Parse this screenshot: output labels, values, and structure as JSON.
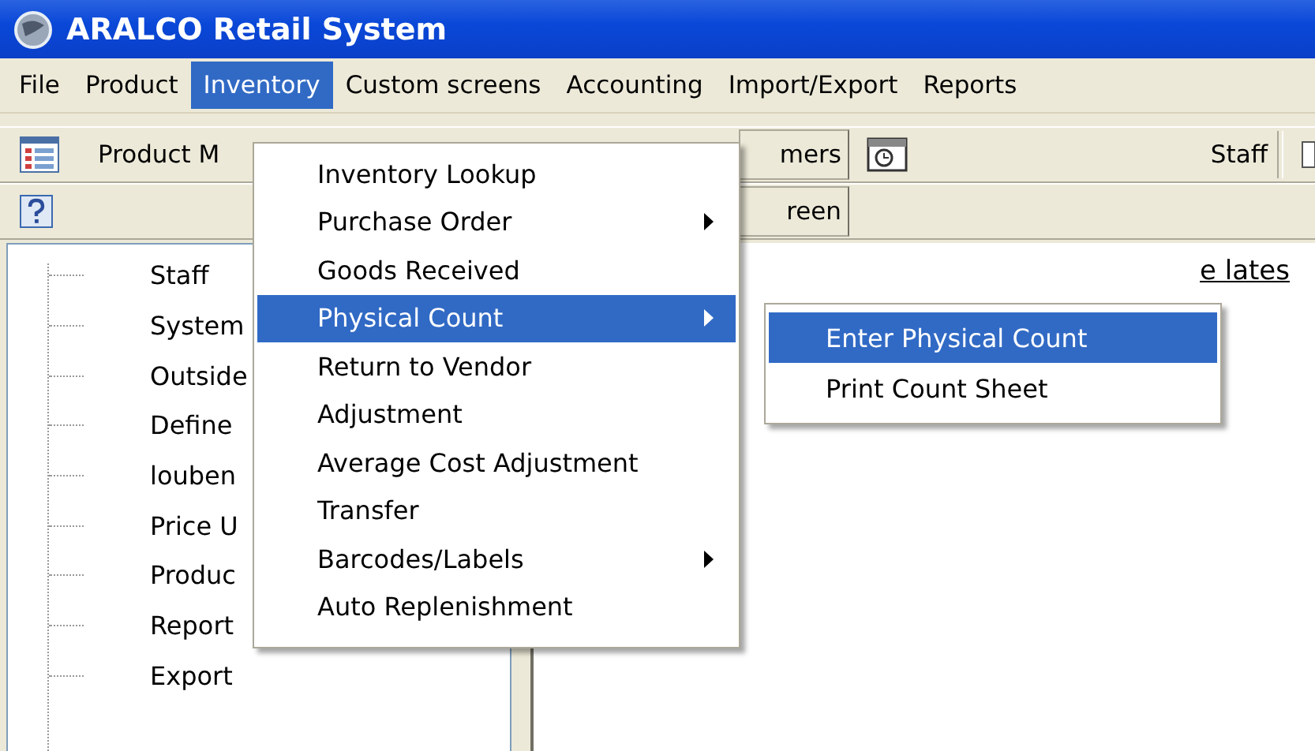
{
  "window": {
    "title": "ARALCO Retail System"
  },
  "menu_bar": [
    {
      "label": "File",
      "selected": false
    },
    {
      "label": "Product",
      "selected": false
    },
    {
      "label": "Inventory",
      "selected": true
    },
    {
      "label": "Custom screens",
      "selected": false
    },
    {
      "label": "Accounting",
      "selected": false
    },
    {
      "label": "Import/Export",
      "selected": false
    },
    {
      "label": "Reports",
      "selected": false
    }
  ],
  "toolbar_1": {
    "product_label": "Product M",
    "button": "mers",
    "staff_label": "Staff"
  },
  "toolbar_2": {
    "button": "reen"
  },
  "tree": {
    "items": [
      {
        "label": "Staff"
      },
      {
        "label": "System"
      },
      {
        "label": "Outside"
      },
      {
        "label": "Define"
      },
      {
        "label": "louben"
      },
      {
        "label": "Price U"
      },
      {
        "label": "Produc"
      },
      {
        "label": "Report"
      },
      {
        "label": "Export"
      }
    ]
  },
  "content": {
    "link": "e lates"
  },
  "inventory_menu": [
    {
      "label": "Inventory Lookup",
      "selected": false,
      "has_submenu": false
    },
    {
      "label": "Purchase Order",
      "selected": false,
      "has_submenu": true
    },
    {
      "label": "Goods Received",
      "selected": false,
      "has_submenu": false
    },
    {
      "label": "Physical Count",
      "selected": true,
      "has_submenu": true
    },
    {
      "label": "Return to Vendor",
      "selected": false,
      "has_submenu": false
    },
    {
      "label": "Adjustment",
      "selected": false,
      "has_submenu": false
    },
    {
      "label": "Average Cost Adjustment",
      "selected": false,
      "has_submenu": false
    },
    {
      "label": "Transfer",
      "selected": false,
      "has_submenu": false
    },
    {
      "label": "Barcodes/Labels",
      "selected": false,
      "has_submenu": true
    },
    {
      "label": "Auto Replenishment",
      "selected": false,
      "has_submenu": false
    }
  ],
  "submenu": [
    {
      "label": "Enter Physical Count",
      "selected": true
    },
    {
      "label": "Print Count Sheet",
      "selected": false
    }
  ]
}
